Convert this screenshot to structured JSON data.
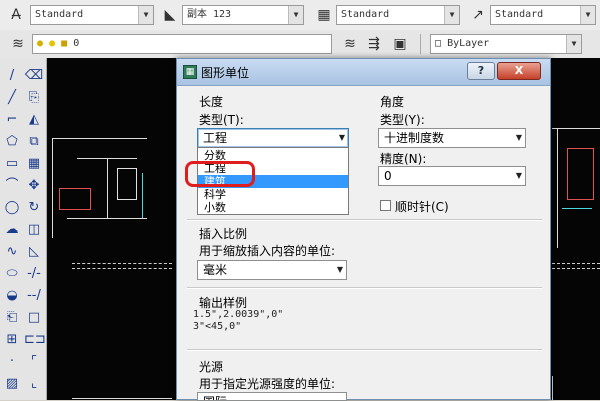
{
  "toolbar_top": {
    "text_style": "Standard",
    "dim_style": "副本 123",
    "table_style": "Standard",
    "multileader_style": "Standard"
  },
  "toolbar_layers": {
    "layer_name": "0",
    "color": "ByLayer"
  },
  "dialog": {
    "title": "图形单位",
    "help_label": "?",
    "close_label": "X",
    "length": {
      "heading": "长度",
      "type_label": "类型(T):",
      "type_value": "工程",
      "options": [
        "分数",
        "工程",
        "建筑",
        "科学",
        "小数"
      ],
      "highlighted_option": "建筑"
    },
    "angle": {
      "heading": "角度",
      "type_label": "类型(Y):",
      "type_value": "十进制度数",
      "precision_label": "精度(N):",
      "precision_value": "0",
      "clockwise_label": "顺时针(C)"
    },
    "insertion_scale": {
      "heading": "插入比例",
      "desc": "用于缩放插入内容的单位:",
      "value": "毫米"
    },
    "output_sample": {
      "heading": "输出样例",
      "line1": "1.5\",2.0039\",0\"",
      "line2": "3\"<45,0\""
    },
    "lighting": {
      "heading": "光源",
      "desc": "用于指定光源强度的单位:",
      "value": "国际"
    }
  }
}
